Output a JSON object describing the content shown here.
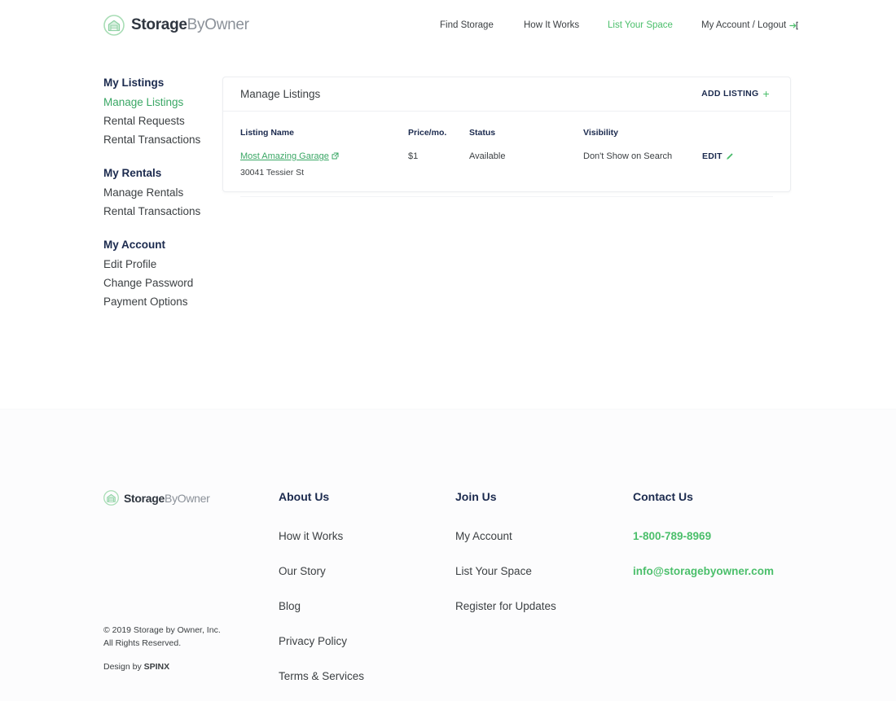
{
  "brand": {
    "name_bold": "Storage",
    "name_light": "ByOwner",
    "logo_icon": "storage-garage-icon",
    "accent_green": "#4bbf6b",
    "link_green": "#3aa765",
    "navy": "#1b2a4e"
  },
  "header": {
    "nav": [
      {
        "label": "Find Storage",
        "active": false
      },
      {
        "label": "How It Works",
        "active": false
      },
      {
        "label": "List Your Space",
        "active": true
      },
      {
        "label": "My Account / Logout",
        "active": false,
        "icon": "logout-icon"
      }
    ]
  },
  "sidebar": {
    "groups": [
      {
        "heading": "My Listings",
        "items": [
          {
            "label": "Manage Listings",
            "active": true
          },
          {
            "label": "Rental Requests",
            "active": false
          },
          {
            "label": "Rental Transactions",
            "active": false
          }
        ]
      },
      {
        "heading": "My Rentals",
        "items": [
          {
            "label": "Manage Rentals",
            "active": false
          },
          {
            "label": "Rental Transactions",
            "active": false
          }
        ]
      },
      {
        "heading": "My Account",
        "items": [
          {
            "label": "Edit Profile",
            "active": false
          },
          {
            "label": "Change Password",
            "active": false
          },
          {
            "label": "Payment Options",
            "active": false
          }
        ]
      }
    ]
  },
  "main": {
    "card_title": "Manage Listings",
    "add_listing_label": "ADD LISTING",
    "add_listing_icon": "plus-icon",
    "table": {
      "headers": {
        "name": "Listing Name",
        "price": "Price/mo.",
        "status": "Status",
        "visibility": "Visibility",
        "action": ""
      },
      "rows": [
        {
          "name": "Most Amazing Garage",
          "name_icon": "external-link-icon",
          "address": "30041 Tessier St",
          "price": "$1",
          "status": "Available",
          "visibility": "Don't Show on Search",
          "edit_label": "EDIT",
          "edit_icon": "pencil-icon"
        }
      ]
    }
  },
  "footer": {
    "copyright_line1": "© 2019 Storage by Owner, Inc.",
    "copyright_line2": "All Rights Reserved.",
    "design_prefix": "Design by ",
    "design_brand": "SPINX",
    "columns": [
      {
        "heading": "About Us",
        "links": [
          {
            "label": "How it Works",
            "style": "plain"
          },
          {
            "label": "Our Story",
            "style": "plain"
          },
          {
            "label": "Blog",
            "style": "plain"
          },
          {
            "label": "Privacy Policy",
            "style": "plain"
          },
          {
            "label": "Terms & Services",
            "style": "plain"
          }
        ]
      },
      {
        "heading": "Join Us",
        "links": [
          {
            "label": "My Account",
            "style": "plain"
          },
          {
            "label": "List Your Space",
            "style": "plain"
          },
          {
            "label": "Register for Updates",
            "style": "plain"
          }
        ]
      },
      {
        "heading": "Contact Us",
        "links": [
          {
            "label": "1-800-789-8969",
            "style": "green"
          },
          {
            "label": "info@storagebyowner.com",
            "style": "green"
          }
        ]
      }
    ]
  }
}
